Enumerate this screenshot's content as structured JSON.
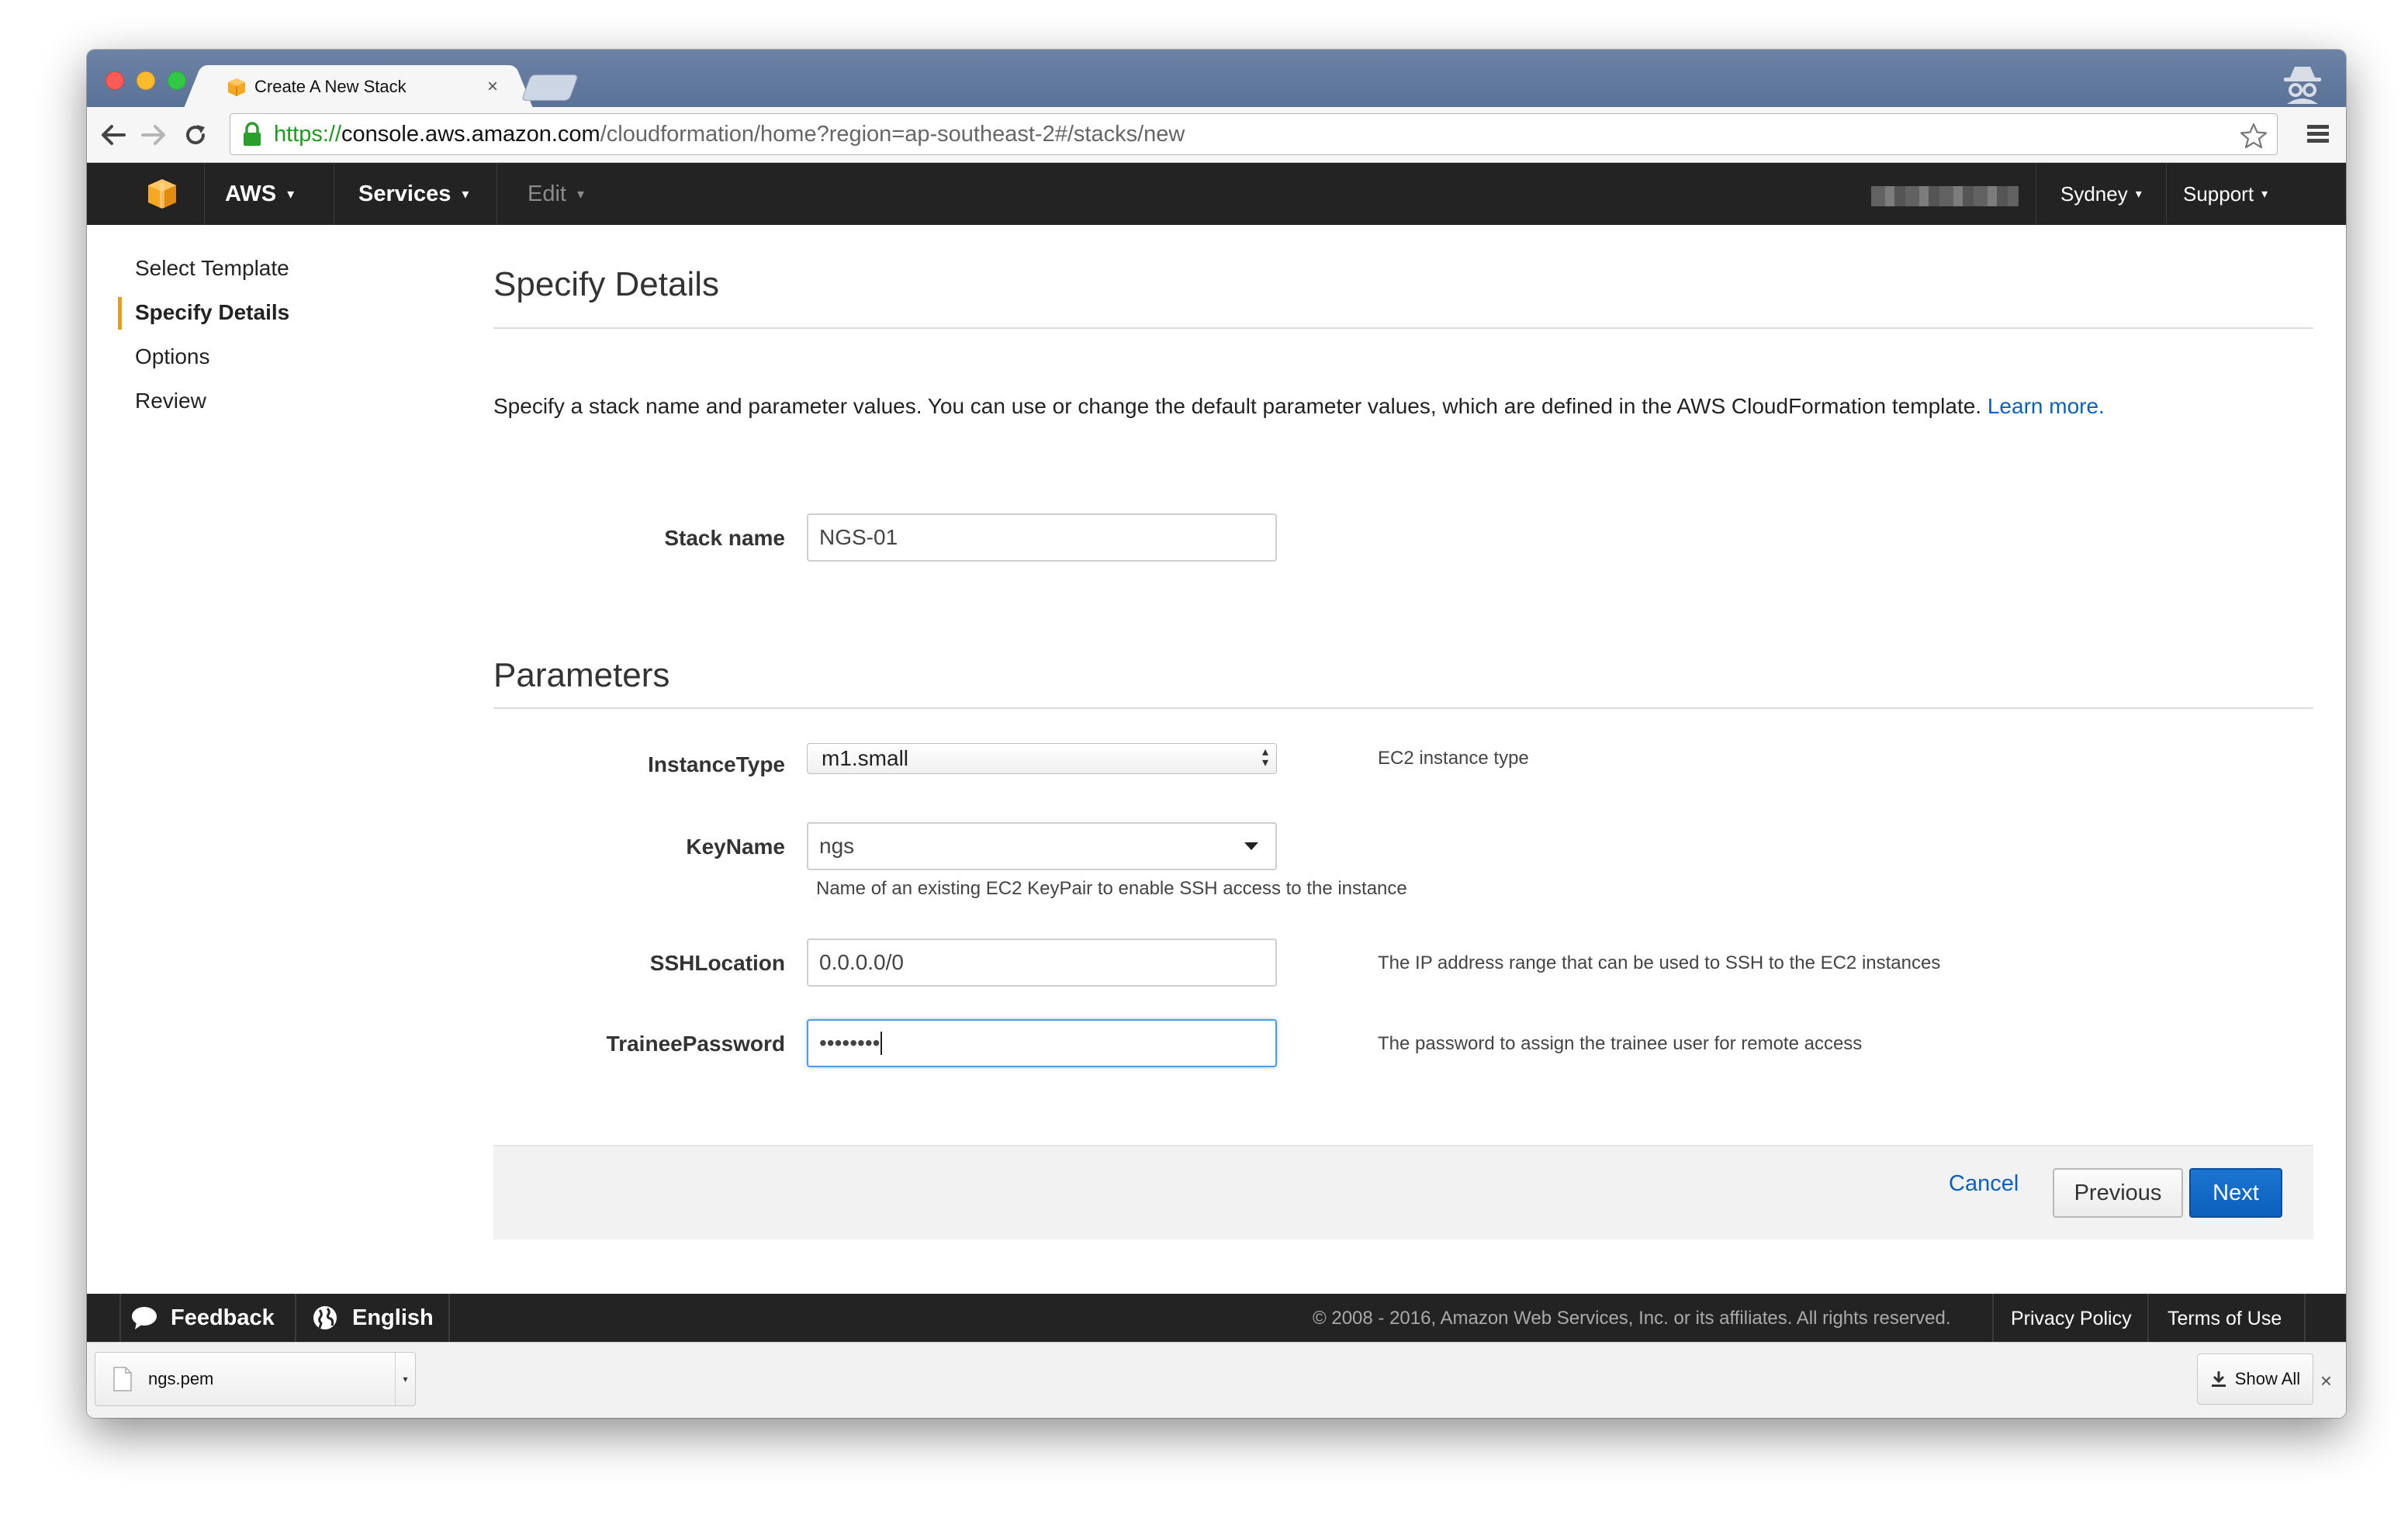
{
  "browser": {
    "tab_title": "Create A New Stack",
    "tab_close": "×",
    "url_scheme": "https://",
    "url_host": "console.aws.amazon.com",
    "url_path": "/cloudformation/home?region=ap-southeast-2#/stacks/new"
  },
  "aws_nav": {
    "aws_label": "AWS",
    "services_label": "Services",
    "edit_label": "Edit",
    "region_label": "Sydney",
    "support_label": "Support",
    "caret": "▾"
  },
  "sidenav": {
    "items": [
      {
        "label": "Select Template"
      },
      {
        "label": "Specify Details"
      },
      {
        "label": "Options"
      },
      {
        "label": "Review"
      }
    ]
  },
  "main": {
    "title": "Specify Details",
    "description": "Specify a stack name and parameter values. You can use or change the default parameter values, which are defined in the AWS CloudFormation template.",
    "learn_more": "Learn more.",
    "stack_name_label": "Stack name",
    "stack_name_value": "NGS-01",
    "parameters_title": "Parameters",
    "instance_type_label": "InstanceType",
    "instance_type_value": "m1.small",
    "instance_type_hint": "EC2 instance type",
    "keyname_label": "KeyName",
    "keyname_value": "ngs",
    "keyname_hint": "Name of an existing EC2 KeyPair to enable SSH access to the instance",
    "sshlocation_label": "SSHLocation",
    "sshlocation_value": "0.0.0.0/0",
    "sshlocation_hint": "The IP address range that can be used to SSH to the EC2 instances",
    "trainee_password_label": "TraineePassword",
    "trainee_password_value": "••••••••",
    "trainee_password_hint": "The password to assign the trainee user for remote access"
  },
  "actions": {
    "cancel": "Cancel",
    "previous": "Previous",
    "next": "Next"
  },
  "footer": {
    "feedback": "Feedback",
    "language": "English",
    "copyright": "© 2008 - 2016, Amazon Web Services, Inc. or its affiliates. All rights reserved.",
    "privacy": "Privacy Policy",
    "terms": "Terms of Use"
  },
  "download_shelf": {
    "file_name": "ngs.pem",
    "show_all": "Show All",
    "close": "×"
  },
  "colors": {
    "accent_orange": "#f09a1a",
    "link_blue": "#0b5fbd",
    "nav_dark": "#232323",
    "next_button": "#0b5fbd"
  }
}
